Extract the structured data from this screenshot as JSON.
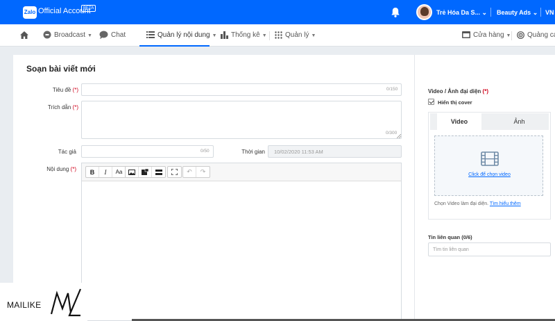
{
  "topbar": {
    "logo": "Zalo",
    "app_name": "Official Account",
    "beta": "BETA",
    "account_name": "Trẻ Hóa Da S...",
    "ads_label": "Beauty Ads",
    "lang": "VN"
  },
  "nav": {
    "items": [
      {
        "label": "Broadcast"
      },
      {
        "label": "Chat"
      },
      {
        "label": "Quản lý nội dung"
      },
      {
        "label": "Thống kê"
      },
      {
        "label": "Quản lý"
      },
      {
        "label": "Cửa hàng"
      },
      {
        "label": "Quảng cáo"
      }
    ],
    "active_item": "Quản lý nội dung"
  },
  "form": {
    "title": "Soạn bài viết mới",
    "title_label": "Tiêu đề",
    "title_count": "0/150",
    "excerpt_label": "Trích dẫn",
    "excerpt_count": "0/300",
    "author_label": "Tác giả",
    "author_count": "0/50",
    "time_label": "Thời gian",
    "time_value": "10/02/2020 11:53 AM",
    "content_label": "Nội dung",
    "required_mark": "(*)"
  },
  "editor_toolbar": {
    "bold": "B",
    "italic": "I",
    "font_size": "Aa"
  },
  "media": {
    "label": "Video / Ảnh đại diện",
    "required_mark": "(*)",
    "show_cover_label": "Hiển thị cover",
    "show_cover_checked": true,
    "tab_video": "Video",
    "tab_image": "Ảnh",
    "active_tab": "Video",
    "choose_video_link": "Click để chọn video",
    "hint_text": "Chọn Video làm đại diện.",
    "learn_more_link": "Tìm hiểu thêm"
  },
  "related": {
    "label": "Tin liên quan (0/6)",
    "placeholder": "Tìm tin liên quan"
  },
  "watermark": {
    "text": "MAILIKE",
    "logo_letters": "ML"
  },
  "colors": {
    "brand_blue": "#0068ff",
    "required_red": "#d0021b",
    "page_bg": "#e9edf1"
  }
}
